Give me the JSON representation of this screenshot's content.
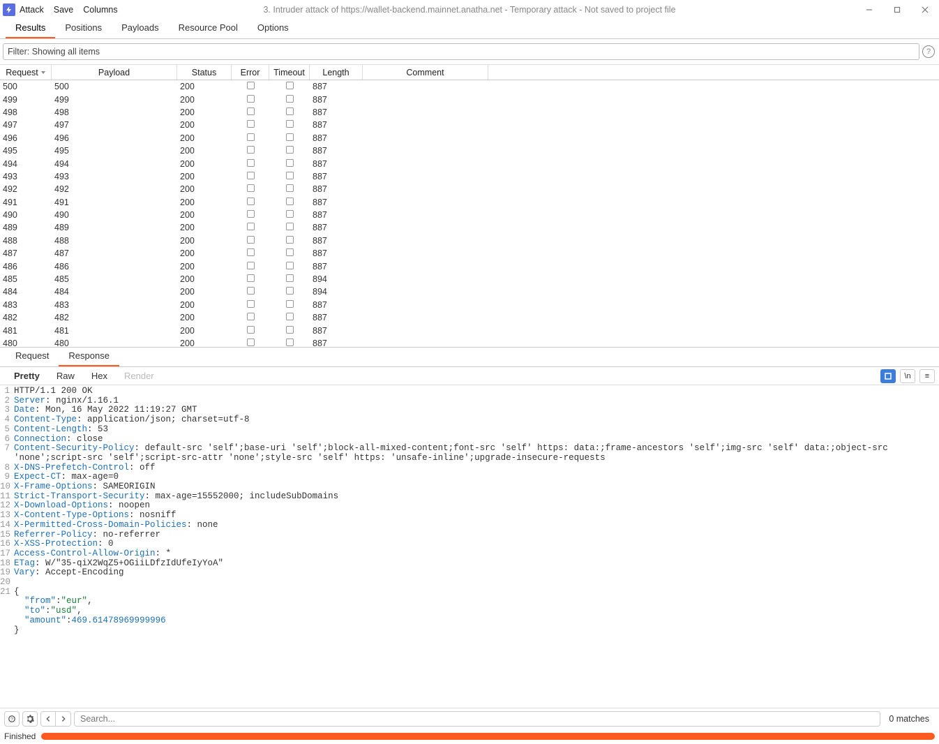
{
  "titlebar": {
    "menu": [
      "Attack",
      "Save",
      "Columns"
    ],
    "title": "3. Intruder attack of https://wallet-backend.mainnet.anatha.net - Temporary attack - Not saved to project file"
  },
  "tabs": {
    "items": [
      "Results",
      "Positions",
      "Payloads",
      "Resource Pool",
      "Options"
    ],
    "activeIndex": 0
  },
  "filter": {
    "text": "Filter: Showing all items"
  },
  "table": {
    "headers": {
      "request": "Request",
      "payload": "Payload",
      "status": "Status",
      "error": "Error",
      "timeout": "Timeout",
      "length": "Length",
      "comment": "Comment"
    },
    "rows": [
      {
        "req": "500",
        "pay": "500",
        "st": "200",
        "len": "887"
      },
      {
        "req": "499",
        "pay": "499",
        "st": "200",
        "len": "887"
      },
      {
        "req": "498",
        "pay": "498",
        "st": "200",
        "len": "887"
      },
      {
        "req": "497",
        "pay": "497",
        "st": "200",
        "len": "887"
      },
      {
        "req": "496",
        "pay": "496",
        "st": "200",
        "len": "887"
      },
      {
        "req": "495",
        "pay": "495",
        "st": "200",
        "len": "887"
      },
      {
        "req": "494",
        "pay": "494",
        "st": "200",
        "len": "887"
      },
      {
        "req": "493",
        "pay": "493",
        "st": "200",
        "len": "887"
      },
      {
        "req": "492",
        "pay": "492",
        "st": "200",
        "len": "887"
      },
      {
        "req": "491",
        "pay": "491",
        "st": "200",
        "len": "887"
      },
      {
        "req": "490",
        "pay": "490",
        "st": "200",
        "len": "887"
      },
      {
        "req": "489",
        "pay": "489",
        "st": "200",
        "len": "887"
      },
      {
        "req": "488",
        "pay": "488",
        "st": "200",
        "len": "887"
      },
      {
        "req": "487",
        "pay": "487",
        "st": "200",
        "len": "887"
      },
      {
        "req": "486",
        "pay": "486",
        "st": "200",
        "len": "887"
      },
      {
        "req": "485",
        "pay": "485",
        "st": "200",
        "len": "894"
      },
      {
        "req": "484",
        "pay": "484",
        "st": "200",
        "len": "894"
      },
      {
        "req": "483",
        "pay": "483",
        "st": "200",
        "len": "887"
      },
      {
        "req": "482",
        "pay": "482",
        "st": "200",
        "len": "887"
      },
      {
        "req": "481",
        "pay": "481",
        "st": "200",
        "len": "887"
      },
      {
        "req": "480",
        "pay": "480",
        "st": "200",
        "len": "887"
      }
    ]
  },
  "rrTabs": {
    "items": [
      "Request",
      "Response"
    ],
    "activeIndex": 1
  },
  "viewTabs": {
    "items": [
      "Pretty",
      "Raw",
      "Hex",
      "Render"
    ],
    "activeIndex": 0
  },
  "viewRight": {
    "nl": "\\n",
    "menu": "≡"
  },
  "response": {
    "lines": [
      {
        "n": 1,
        "t": "status",
        "v": "HTTP/1.1 200 OK"
      },
      {
        "n": 2,
        "t": "h",
        "k": "Server",
        "v": " nginx/1.16.1"
      },
      {
        "n": 3,
        "t": "h",
        "k": "Date",
        "v": " Mon, 16 May 2022 11:19:27 GMT"
      },
      {
        "n": 4,
        "t": "h",
        "k": "Content-Type",
        "v": " application/json; charset=utf-8"
      },
      {
        "n": 5,
        "t": "h",
        "k": "Content-Length",
        "v": " 53"
      },
      {
        "n": 6,
        "t": "h",
        "k": "Connection",
        "v": " close"
      },
      {
        "n": 7,
        "t": "h",
        "k": "Content-Security-Policy",
        "v": " default-src 'self';base-uri 'self';block-all-mixed-content;font-src 'self' https: data:;frame-ancestors 'self';img-src 'self' data:;object-src 'none';script-src 'self';script-src-attr 'none';style-src 'self' https: 'unsafe-inline';upgrade-insecure-requests"
      },
      {
        "n": 8,
        "t": "h",
        "k": "X-DNS-Prefetch-Control",
        "v": " off"
      },
      {
        "n": 9,
        "t": "h",
        "k": "Expect-CT",
        "v": " max-age=0"
      },
      {
        "n": 10,
        "t": "h",
        "k": "X-Frame-Options",
        "v": " SAMEORIGIN"
      },
      {
        "n": 11,
        "t": "h",
        "k": "Strict-Transport-Security",
        "v": " max-age=15552000; includeSubDomains"
      },
      {
        "n": 12,
        "t": "h",
        "k": "X-Download-Options",
        "v": " noopen"
      },
      {
        "n": 13,
        "t": "h",
        "k": "X-Content-Type-Options",
        "v": " nosniff"
      },
      {
        "n": 14,
        "t": "h",
        "k": "X-Permitted-Cross-Domain-Policies",
        "v": " none"
      },
      {
        "n": 15,
        "t": "h",
        "k": "Referrer-Policy",
        "v": " no-referrer"
      },
      {
        "n": 16,
        "t": "h",
        "k": "X-XSS-Protection",
        "v": " 0"
      },
      {
        "n": 17,
        "t": "h",
        "k": "Access-Control-Allow-Origin",
        "v": " *"
      },
      {
        "n": 18,
        "t": "h",
        "k": "ETag",
        "v": " W/\"35-qiX2WqZ5+OGiiLDfzIdUfeIyYoA\""
      },
      {
        "n": 19,
        "t": "h",
        "k": "Vary",
        "v": " Accept-Encoding"
      },
      {
        "n": 20,
        "t": "blank"
      },
      {
        "n": 21,
        "t": "json"
      }
    ],
    "json": {
      "from": "eur",
      "to": "usd",
      "amount": "469.61478969999996"
    }
  },
  "search": {
    "placeholder": "Search...",
    "matches": "0 matches"
  },
  "status": {
    "label": "Finished"
  }
}
